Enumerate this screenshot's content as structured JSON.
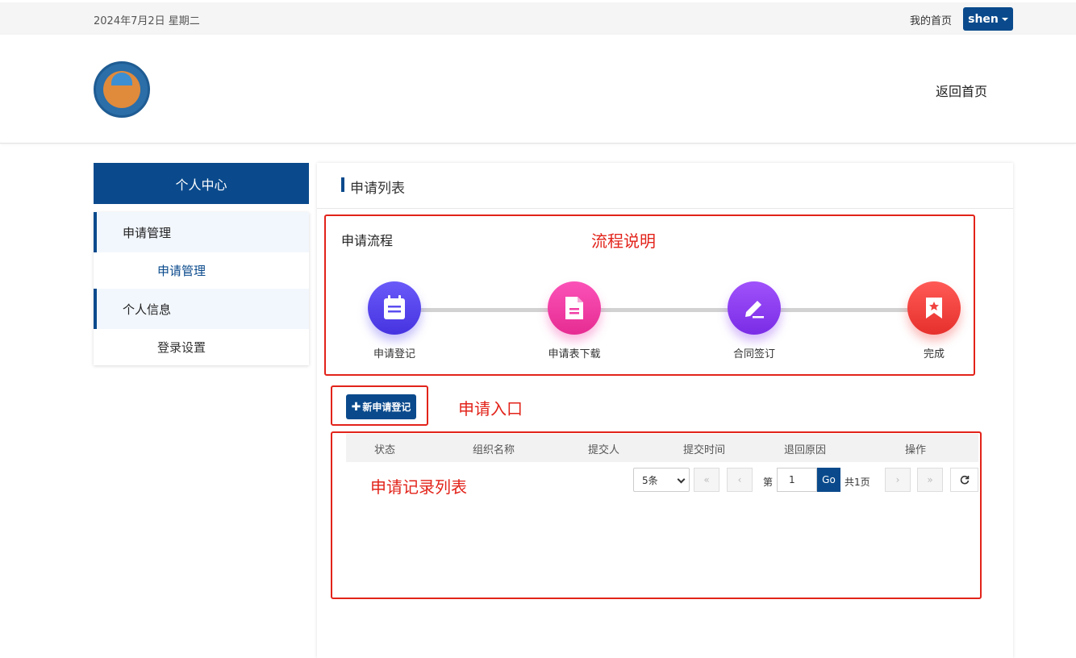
{
  "topbar": {
    "date": "2024年7月2日 星期二",
    "home_link": "我的首页",
    "user": "shen"
  },
  "header": {
    "back_home": "返回首页"
  },
  "sidebar": {
    "title": "个人中心",
    "groups": [
      {
        "label": "申请管理",
        "sub": "申请管理"
      },
      {
        "label": "个人信息",
        "sub": "登录设置"
      }
    ]
  },
  "main": {
    "title": "申请列表",
    "flow_title": "申请流程",
    "steps": [
      {
        "label": "申请登记",
        "icon": "calendar-icon",
        "color": "#5b4df0"
      },
      {
        "label": "申请表下载",
        "icon": "document-icon",
        "color": "#f03fa5"
      },
      {
        "label": "合同签订",
        "icon": "pen-icon",
        "color": "#8a3ff0"
      },
      {
        "label": "完成",
        "icon": "bookmark-star-icon",
        "color": "#f0433f"
      }
    ],
    "new_button": "新申请登记",
    "table_headers": [
      "状态",
      "组织名称",
      "提交人",
      "提交时间",
      "退回原因",
      "操作"
    ],
    "pager": {
      "page_size": "5条",
      "page_prefix": "第",
      "page_value": "1",
      "go": "Go",
      "total": "共1页",
      "first": "«",
      "prev": "‹",
      "next": "›",
      "last": "»"
    }
  },
  "annotations": {
    "flow": "流程说明",
    "entry": "申请入口",
    "records": "申请记录列表",
    "color": "#e2231a"
  }
}
